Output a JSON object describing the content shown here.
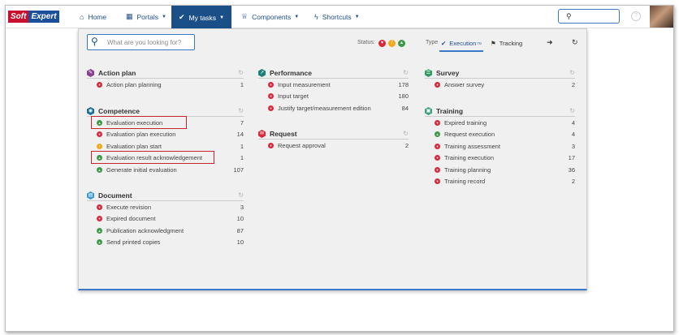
{
  "logo": {
    "part1": "Soft",
    "part2": "Expert"
  },
  "nav": {
    "home": "Home",
    "portals": "Portals",
    "my_tasks": "My tasks",
    "components": "Components",
    "shortcuts": "Shortcuts"
  },
  "panel": {
    "search_placeholder": "What are you looking for?",
    "status_label": "Status:",
    "type_label": "Type",
    "tab_execution": "Execution",
    "tab_execution_sup": "TB",
    "tab_tracking": "Tracking"
  },
  "colors": {
    "accent": "#1b4f88",
    "red": "#d9283a",
    "yellow": "#f2a91a",
    "green": "#3f9a48"
  },
  "sections": {
    "action_plan": {
      "title": "Action plan",
      "items": [
        {
          "label": "Action plan planning",
          "count": "1"
        }
      ]
    },
    "competence": {
      "title": "Competence",
      "items": [
        {
          "label": "Evaluation execution",
          "count": "7"
        },
        {
          "label": "Evaluation plan execution",
          "count": "14"
        },
        {
          "label": "Evaluation plan start",
          "count": "1"
        },
        {
          "label": "Evaluation result acknowledgement",
          "count": "1"
        },
        {
          "label": "Generate initial evaluation",
          "count": "107"
        }
      ]
    },
    "document": {
      "title": "Document",
      "items": [
        {
          "label": "Execute revision",
          "count": "3"
        },
        {
          "label": "Expired document",
          "count": "10"
        },
        {
          "label": "Publication acknowledgment",
          "count": "87"
        },
        {
          "label": "Send printed copies",
          "count": "10"
        }
      ]
    },
    "performance": {
      "title": "Performance",
      "items": [
        {
          "label": "Input measurement",
          "count": "178"
        },
        {
          "label": "Input target",
          "count": "180"
        },
        {
          "label": "Justify target/measurement edition",
          "count": "84"
        }
      ]
    },
    "request": {
      "title": "Request",
      "items": [
        {
          "label": "Request approval",
          "count": "2"
        }
      ]
    },
    "survey": {
      "title": "Survey",
      "items": [
        {
          "label": "Answer survey",
          "count": "2"
        }
      ]
    },
    "training": {
      "title": "Training",
      "items": [
        {
          "label": "Expired training",
          "count": "4"
        },
        {
          "label": "Request execution",
          "count": "4"
        },
        {
          "label": "Training assessment",
          "count": "3"
        },
        {
          "label": "Training execution",
          "count": "17"
        },
        {
          "label": "Training planning",
          "count": "36"
        },
        {
          "label": "Training record",
          "count": "2"
        }
      ]
    }
  }
}
